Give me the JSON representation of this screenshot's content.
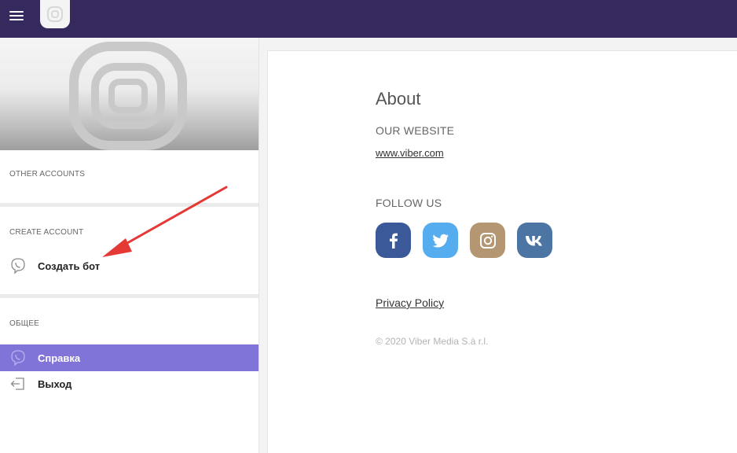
{
  "topbar": {
    "menu_icon": "hamburger-icon",
    "logo_icon": "viber-logo-icon",
    "color": "#35295e"
  },
  "sidebar": {
    "other_accounts_title": "OTHER ACCOUNTS",
    "create_account_title": "CREATE ACCOUNT",
    "create_bot_label": "Создать бот",
    "general_title": "ОБЩЕЕ",
    "help_label": "Справка",
    "logout_label": "Выход",
    "active_color": "#8074d8"
  },
  "main": {
    "about_title": "About",
    "website_title": "OUR WEBSITE",
    "website_link": "www.viber.com",
    "follow_title": "FOLLOW US",
    "social": [
      {
        "name": "facebook",
        "color": "#3b5998"
      },
      {
        "name": "twitter",
        "color": "#55acee"
      },
      {
        "name": "instagram",
        "color": "#b59672"
      },
      {
        "name": "vk",
        "color": "#4c75a3"
      }
    ],
    "privacy_label": "Privacy Policy",
    "copyright": "© 2020 Viber Media S.à r.l."
  }
}
